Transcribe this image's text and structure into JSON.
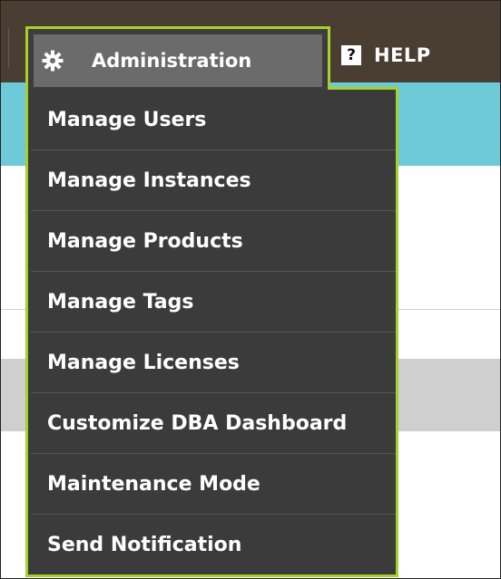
{
  "nav": {
    "admin_label": "Administration",
    "admin_icon": "gear-icon",
    "help_icon_glyph": "?",
    "help_label": "HELP"
  },
  "menu": {
    "items": [
      {
        "label": "Manage Users"
      },
      {
        "label": "Manage Instances"
      },
      {
        "label": "Manage Products"
      },
      {
        "label": "Manage Tags"
      },
      {
        "label": "Manage Licenses"
      },
      {
        "label": "Customize DBA Dashboard"
      },
      {
        "label": "Maintenance Mode"
      },
      {
        "label": "Send Notification"
      }
    ]
  },
  "colors": {
    "topbar": "#4a3d32",
    "accent_outline": "#a6d12a",
    "menu_bg": "#3b3b3b",
    "teal": "#6ec9d8"
  }
}
